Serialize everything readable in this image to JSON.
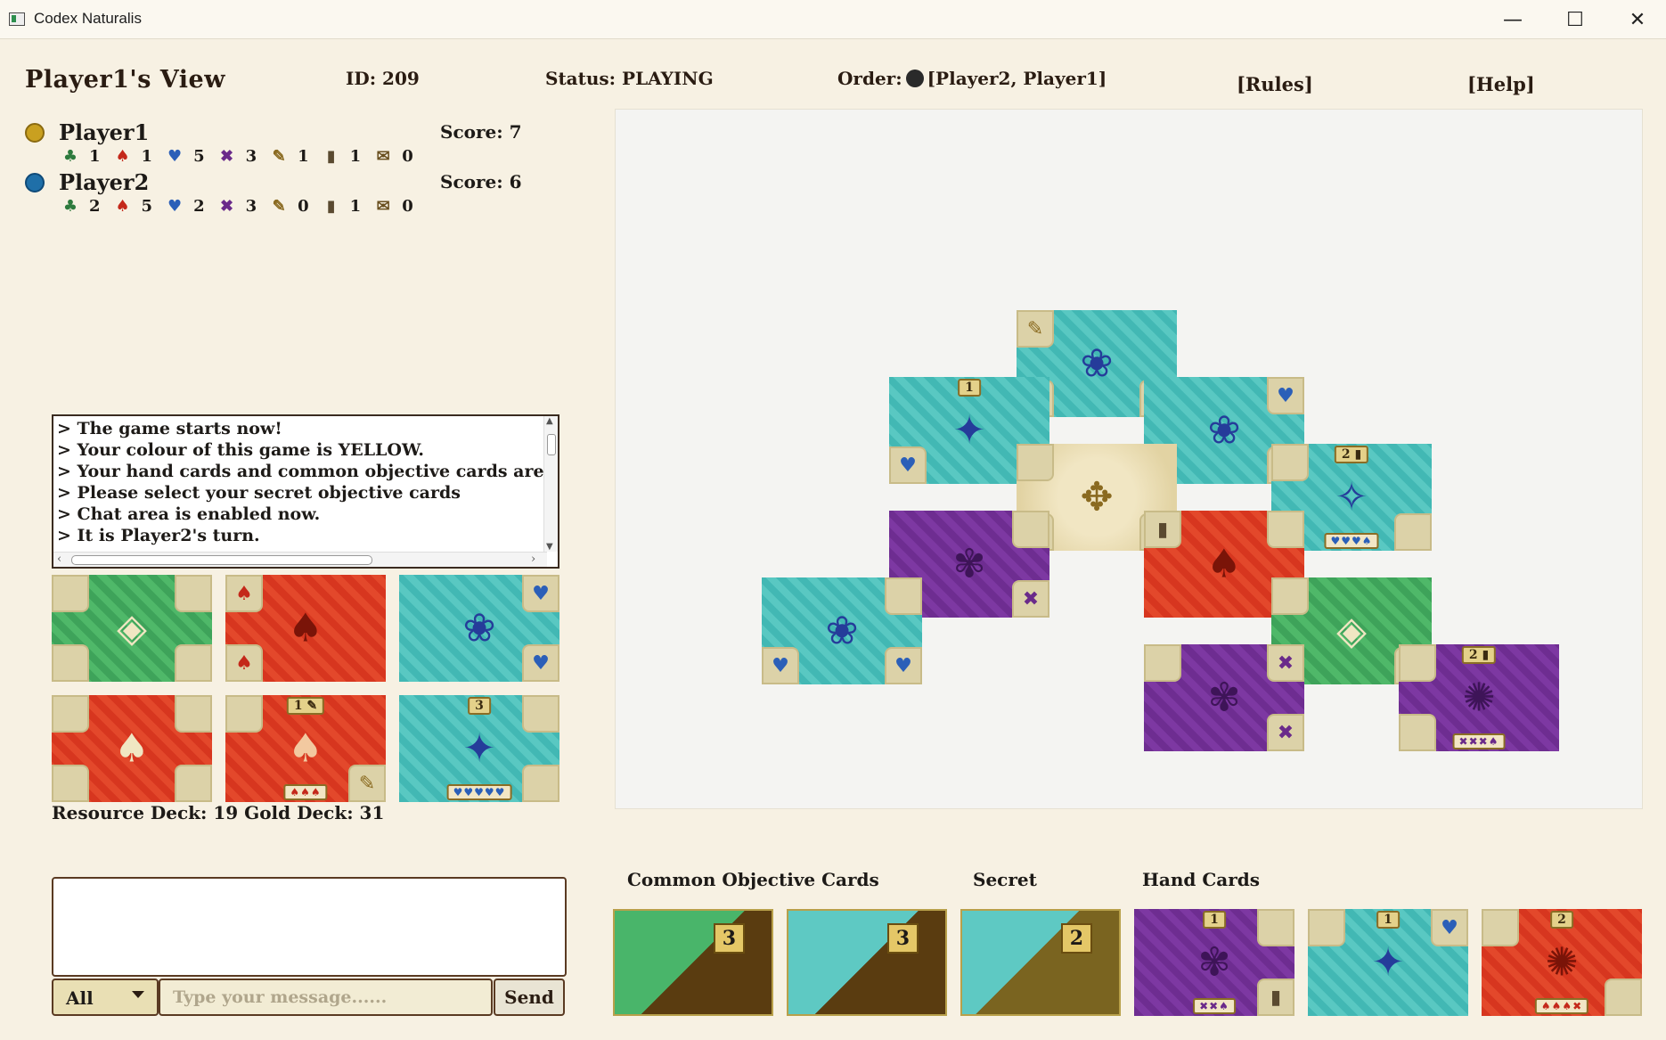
{
  "window": {
    "title": "Codex Naturalis",
    "minimize": "—",
    "maximize": "☐",
    "close": "✕"
  },
  "header": {
    "view_title": "Player1's View",
    "game_id": "ID: 209",
    "status": "Status: PLAYING",
    "order_label": "Order:",
    "order_players": "[Player2, Player1]",
    "rules_link": "[Rules]",
    "help_link": "[Help]"
  },
  "players": [
    {
      "name": "Player1",
      "token_color": "#c9a020",
      "score": "Score: 7",
      "resources": {
        "plant": "1",
        "fungi": "1",
        "animal": "5",
        "insect": "3",
        "quill": "1",
        "inkwell": "1",
        "manuscript": "0"
      }
    },
    {
      "name": "Player2",
      "token_color": "#1f6fa8",
      "score": "Score: 6",
      "resources": {
        "plant": "2",
        "fungi": "5",
        "animal": "2",
        "insect": "3",
        "quill": "0",
        "inkwell": "1",
        "manuscript": "0"
      }
    }
  ],
  "chat_log": [
    "> The game starts now!",
    "> Your colour of this game is YELLOW.",
    "> Your hand cards and common objective cards are",
    "> Please select your secret objective cards",
    "> Chat area is enabled now.",
    "> It is Player2's turn."
  ],
  "decks": {
    "caption": "Resource Deck:  19   Gold Deck:  31"
  },
  "sections": {
    "common_objective": "Common Objective Cards",
    "secret": "Secret",
    "hand": "Hand Cards"
  },
  "chat": {
    "recipient": "All",
    "placeholder": "Type your message......",
    "send_label": "Send"
  },
  "objective_points": [
    "3",
    "3",
    "2"
  ],
  "hand_points": [
    "1",
    "1",
    "2"
  ],
  "colors": {
    "background": "#f7f1e3",
    "plant": "#3ea35a",
    "fungi": "#d7361f",
    "animal": "#42b8b4",
    "insect": "#6e2d91"
  }
}
